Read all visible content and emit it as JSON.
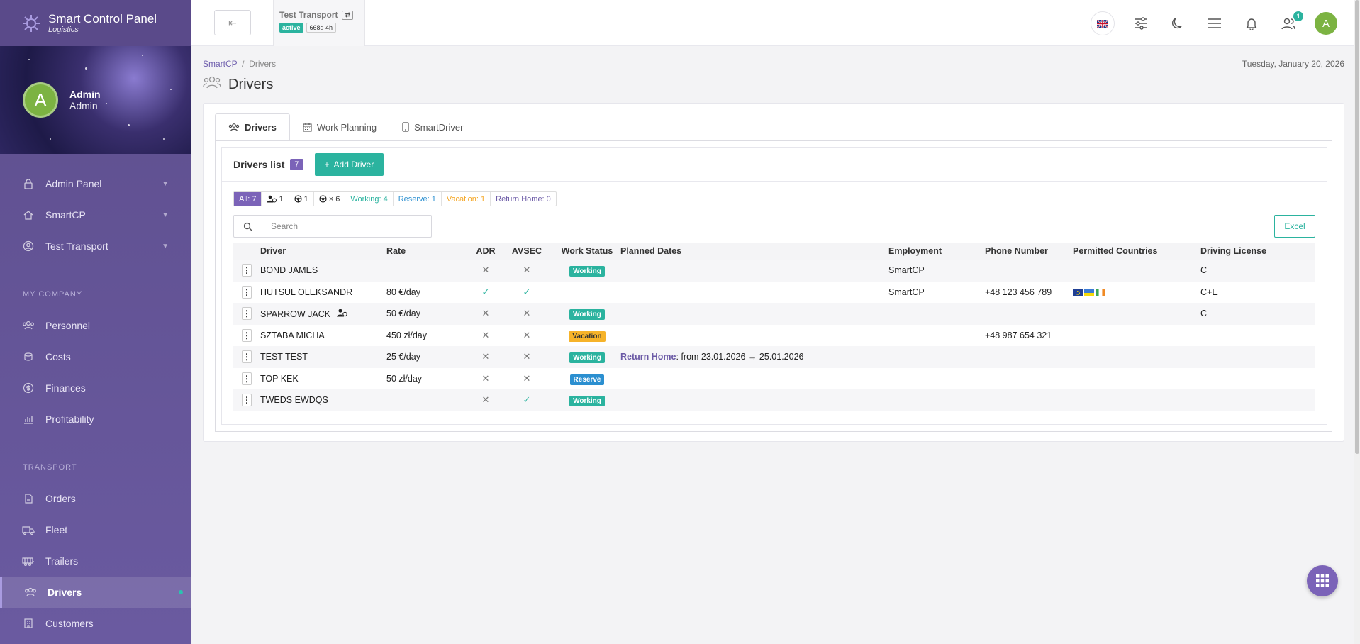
{
  "sidebar": {
    "brand_name": "Smart Control Panel",
    "brand_sub": "Logistics",
    "user_name": "Admin",
    "user_role": "Admin",
    "user_initial": "A",
    "items": [
      {
        "label": "Admin Panel",
        "icon": "lock-icon"
      },
      {
        "label": "SmartCP",
        "icon": "home-icon"
      },
      {
        "label": "Test Transport",
        "icon": "user-circle-icon"
      }
    ],
    "section_company": "MY COMPANY",
    "company_items": [
      {
        "label": "Personnel"
      },
      {
        "label": "Costs"
      },
      {
        "label": "Finances"
      },
      {
        "label": "Profitability"
      }
    ],
    "section_transport": "TRANSPORT",
    "transport_items": [
      {
        "label": "Orders"
      },
      {
        "label": "Fleet"
      },
      {
        "label": "Trailers"
      },
      {
        "label": "Drivers"
      },
      {
        "label": "Customers"
      }
    ]
  },
  "topbar": {
    "company_name": "Test Transport",
    "status": "active",
    "uptime": "668d 4h",
    "notif_count": "1",
    "avatar_initial": "A"
  },
  "page": {
    "crumb_root": "SmartCP",
    "crumb_sep": "/",
    "crumb_current": "Drivers",
    "date": "Tuesday, January 20, 2026",
    "title": "Drivers"
  },
  "tabs": [
    "Drivers",
    "Work Planning",
    "SmartDriver"
  ],
  "list": {
    "title": "Drivers list",
    "count": "7",
    "add_label": "Add Driver",
    "search_placeholder": "Search",
    "excel_label": "Excel"
  },
  "filters": {
    "all": "All: 7",
    "f1": "1",
    "f2": "1",
    "f3": "× 6",
    "working": "Working: 4",
    "reserve": "Reserve: 1",
    "vacation": "Vacation: 1",
    "return_home": "Return Home: 0"
  },
  "columns": [
    "Driver",
    "Rate",
    "ADR",
    "AVSEC",
    "Work Status",
    "Planned Dates",
    "Employment",
    "Phone Number",
    "Permitted Countries",
    "Driving License"
  ],
  "rows": [
    {
      "driver": "BOND JAMES",
      "rate": "",
      "adr": "x",
      "avsec": "x",
      "status": "Working",
      "planned_label": "",
      "planned": "",
      "employment": "SmartCP",
      "phone": "",
      "flags": false,
      "license": "C"
    },
    {
      "driver": "HUTSUL OLEKSANDR",
      "rate": "80 €/day",
      "adr": "ok",
      "avsec": "ok",
      "status": "",
      "planned_label": "",
      "planned": "",
      "employment": "SmartCP",
      "phone": "+48 123 456 789",
      "flags": true,
      "license": "C+E"
    },
    {
      "driver": "SPARROW JACK",
      "rate": "50 €/day",
      "adr": "x",
      "avsec": "x",
      "status": "Working",
      "planned_label": "",
      "planned": "",
      "employment": "",
      "phone": "",
      "flags": false,
      "license": "C"
    },
    {
      "driver": "SZTABA MICHA",
      "rate": "450 zł/day",
      "adr": "x",
      "avsec": "x",
      "status": "Vacation",
      "planned_label": "",
      "planned": "",
      "employment": "",
      "phone": "+48 987 654 321",
      "flags": false,
      "license": ""
    },
    {
      "driver": "TEST TEST",
      "rate": "25 €/day",
      "adr": "x",
      "avsec": "x",
      "status": "Working",
      "planned_label": "Return Home",
      "planned": ": from 23.01.2026 → 25.01.2026",
      "employment": "",
      "phone": "",
      "flags": false,
      "license": ""
    },
    {
      "driver": "TOP KEK",
      "rate": "50 zł/day",
      "adr": "x",
      "avsec": "x",
      "status": "Reserve",
      "planned_label": "",
      "planned": "",
      "employment": "",
      "phone": "",
      "flags": false,
      "license": ""
    },
    {
      "driver": "TWEDS EWDQS",
      "rate": "",
      "adr": "x",
      "avsec": "ok",
      "status": "Working",
      "planned_label": "",
      "planned": "",
      "employment": "",
      "phone": "",
      "flags": false,
      "license": ""
    }
  ],
  "colors": {
    "accent": "#7b63b8",
    "teal": "#2bb39f",
    "reserve": "#2b8fd0",
    "vacation": "#f6b32a"
  }
}
